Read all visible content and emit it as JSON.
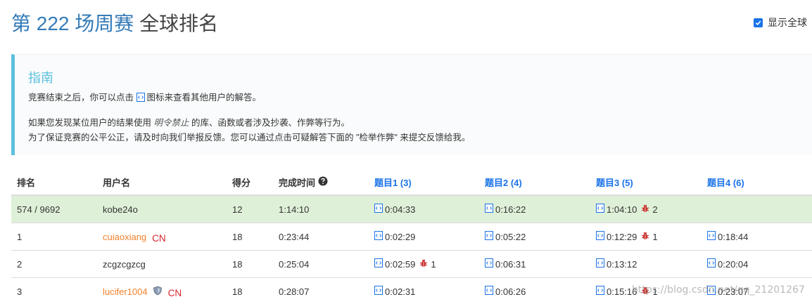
{
  "header": {
    "contest": "第 222 场周赛",
    "ranking_word": "全球排名"
  },
  "toggle": {
    "label": "显示全球",
    "checked": true,
    "color": "#1a73e8"
  },
  "guide": {
    "title": "指南",
    "line1_pre": "竞赛结束之后，你可以点击",
    "line1_post": "图标来查看其他用户的解答。",
    "line2_pre": "如果您发现某位用户的结果使用",
    "line2_em": "明令禁止",
    "line2_post": "的库、函数或者涉及抄袭、作弊等行为。",
    "line3": "为了保证竞赛的公平公正，请及时向我们举报反馈。您可以通过点击可疑解答下面的 \"检举作弊\" 来提交反馈给我。"
  },
  "table": {
    "headers": {
      "rank": "排名",
      "user": "用户名",
      "score": "得分",
      "time": "完成时间",
      "q1": "题目1 (3)",
      "q2": "题目2 (4)",
      "q3": "题目3 (5)",
      "q4": "题目4 (6)"
    },
    "rows": [
      {
        "rank": "574 / 9692",
        "user": "kobe24o",
        "region": "",
        "score": "12",
        "time": "1:14:10",
        "q1": "0:04:33",
        "q2": "0:16:22",
        "q3": "1:04:10",
        "q3_bug": "2",
        "q4": "",
        "q1_bug": "",
        "q2_bug": ""
      },
      {
        "rank": "1",
        "user": "cuiaoxiang",
        "region": "CN",
        "score": "18",
        "time": "0:23:44",
        "q1": "0:02:29",
        "q2": "0:05:22",
        "q3": "0:12:29",
        "q3_bug": "1",
        "q4": "0:18:44",
        "q1_bug": "",
        "q2_bug": ""
      },
      {
        "rank": "2",
        "user": "zcgzcgzcg",
        "region": "",
        "score": "18",
        "time": "0:25:04",
        "q1": "0:02:59",
        "q1_bug": "1",
        "q2": "0:06:31",
        "q3": "0:13:12",
        "q3_bug": "",
        "q4": "0:20:04",
        "q2_bug": ""
      },
      {
        "rank": "3",
        "user": "lucifer1004",
        "region": "CN",
        "score": "18",
        "time": "0:28:07",
        "q1": "0:02:31",
        "q2": "0:06:26",
        "q3": "0:15:16",
        "q3_bug": "1",
        "q4": "0:23:07",
        "q1_bug": "",
        "q2_bug": ""
      }
    ]
  },
  "watermark": "https://blog.csdn.net/qq_21201267",
  "colors": {
    "accent": "#337ab7",
    "link": "#1a73e8",
    "guide": "#5bc0de",
    "highlight": "#dff0d8",
    "cn_user": "#f0812d",
    "region": "#d9232d",
    "bug": "#c9302c"
  }
}
